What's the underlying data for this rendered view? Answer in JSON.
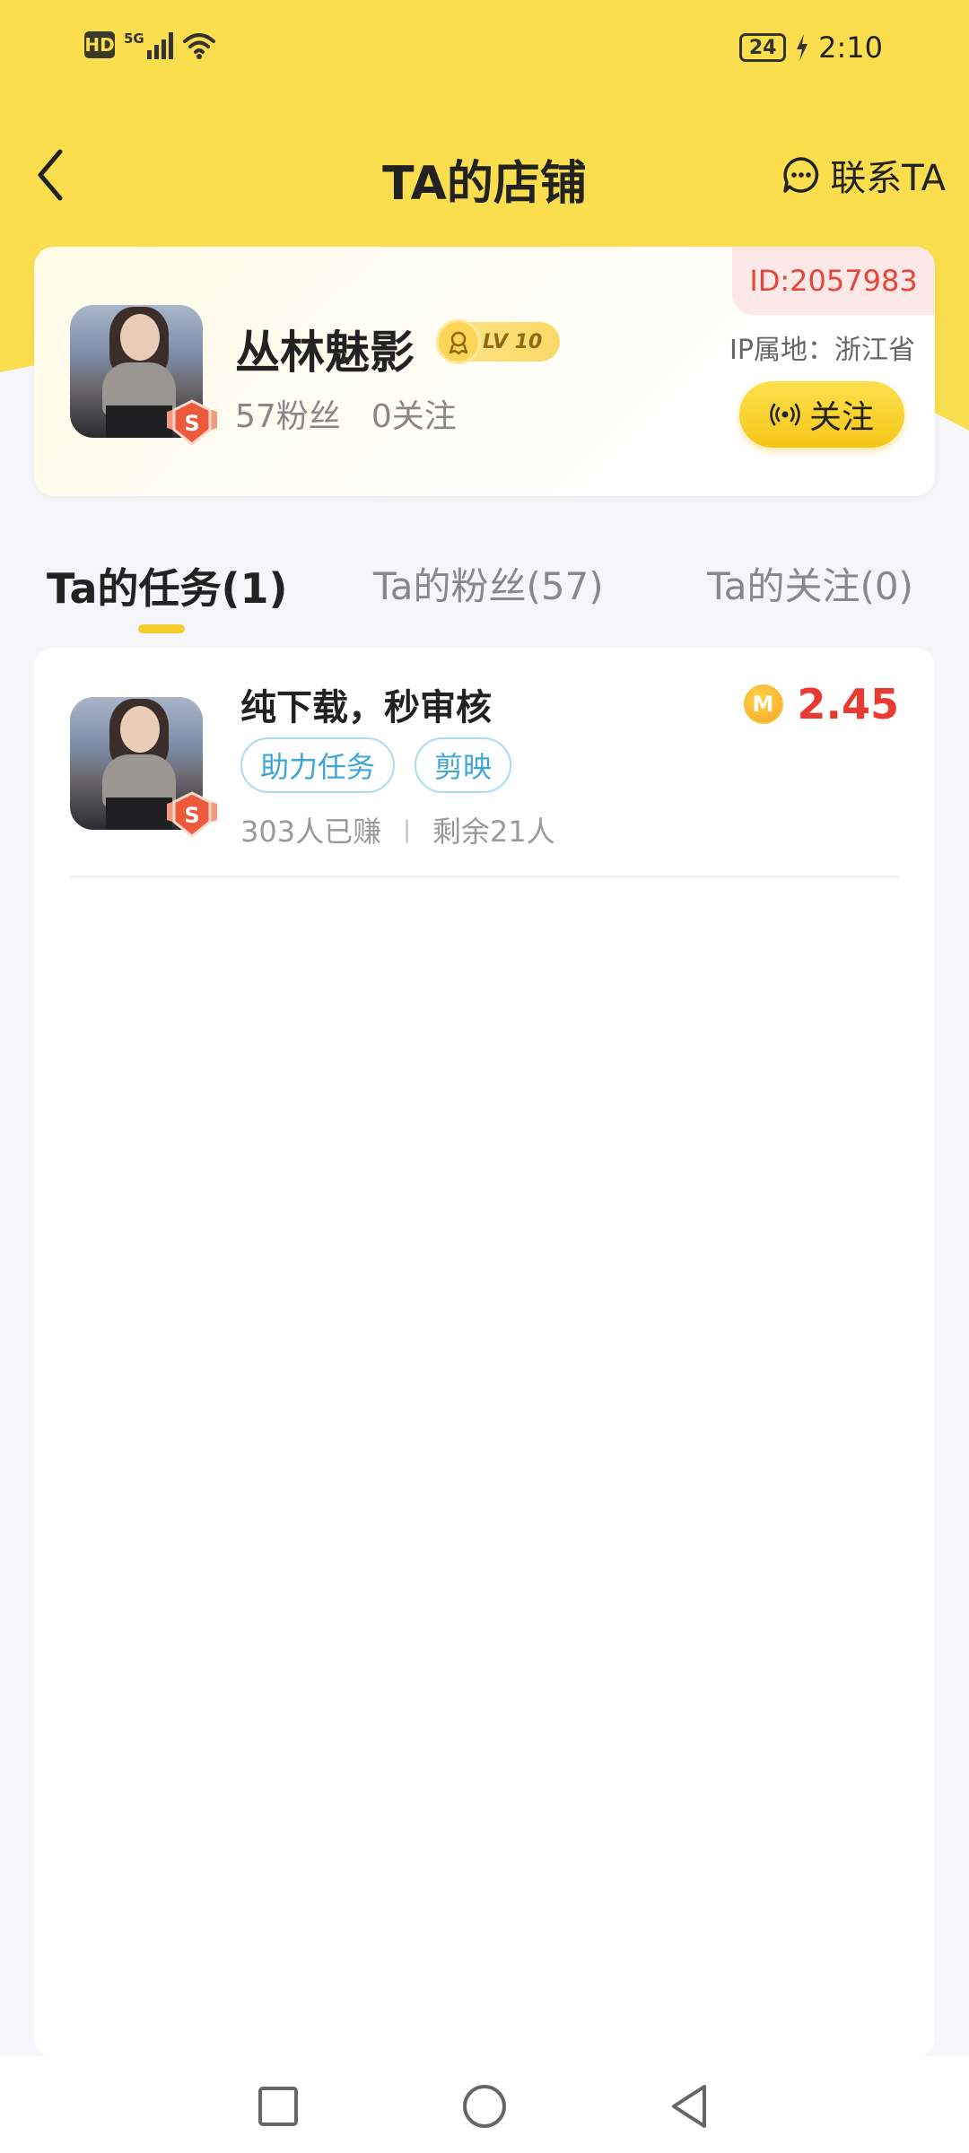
{
  "status_bar": {
    "hd": "HD",
    "network": "5G",
    "battery": "24",
    "time": "2:10"
  },
  "header": {
    "title": "TA的店铺",
    "contact_label": "联系TA"
  },
  "profile": {
    "username": "丛林魅影",
    "level": "LV 10",
    "fans": "57粉丝",
    "following": "0关注",
    "id": "ID:2057983",
    "ip_location": "IP属地：浙江省",
    "follow_label": "关注"
  },
  "tabs": [
    {
      "label": "Ta的任务(1)",
      "active": true
    },
    {
      "label": "Ta的粉丝(57)",
      "active": false
    },
    {
      "label": "Ta的关注(0)",
      "active": false
    }
  ],
  "tasks": [
    {
      "title": "纯下载，秒审核",
      "tags": [
        "助力任务",
        "剪映"
      ],
      "earned": "303人已赚",
      "separator": "|",
      "remaining": "剩余21人",
      "coin_label": "M",
      "reward": "2.45"
    }
  ],
  "colors": {
    "brand_yellow": "#fbde4e",
    "price_red": "#e93a32",
    "tag_blue": "#3ea6d6"
  }
}
